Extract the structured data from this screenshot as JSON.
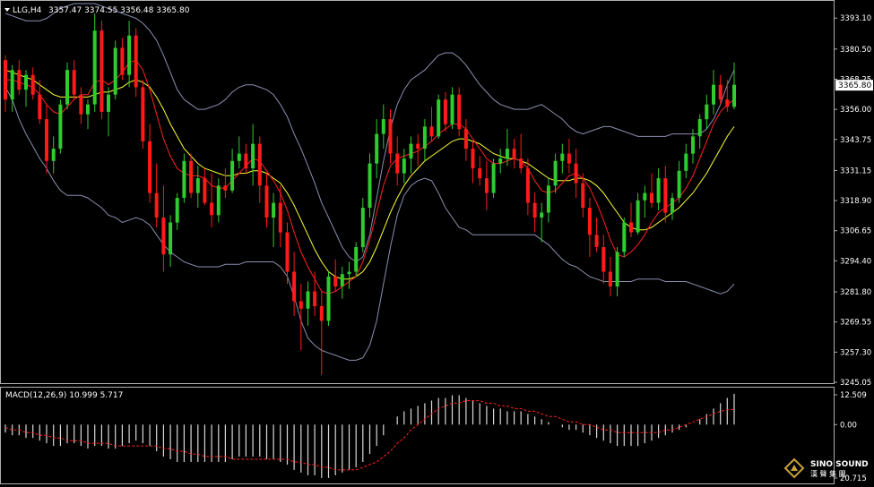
{
  "chart_header": {
    "symbol": "LLG,H4",
    "ohlc": "3357.47 3374.55 3356.48 3365.80"
  },
  "price_axis": {
    "ticks": [
      3393.1,
      3380.5,
      3368.25,
      3356.0,
      3343.75,
      3331.15,
      3318.9,
      3306.65,
      3294.4,
      3281.8,
      3269.55,
      3257.3,
      3245.05
    ],
    "ylim": [
      3245.05,
      3399.0
    ],
    "current_price": "3365.80"
  },
  "macd_panel": {
    "label": "MACD(12,26,9) 10.999 5.717",
    "ticks": [
      "12.509",
      "0.00",
      "20.715"
    ],
    "ylim": [
      -20.715,
      12.509
    ]
  },
  "watermark": {
    "brand": "SINO SOUND",
    "sub": "漢 聲 集 團"
  },
  "colors": {
    "up": "#2ecc2e",
    "down": "#ff1a1a",
    "ma_fast": "#ff2020",
    "ma_slow": "#ffff33",
    "bands": "#8a8fb0",
    "histogram": "#d8d8d8",
    "signal": "#ff2020"
  },
  "chart_data": {
    "type": "candlestick",
    "title": "LLG,H4",
    "candles": [
      [
        3376,
        3378,
        3355,
        3360
      ],
      [
        3360,
        3374,
        3355,
        3372
      ],
      [
        3372,
        3376,
        3362,
        3364
      ],
      [
        3364,
        3372,
        3357,
        3370
      ],
      [
        3370,
        3373,
        3360,
        3362
      ],
      [
        3362,
        3368,
        3350,
        3352
      ],
      [
        3352,
        3358,
        3330,
        3335
      ],
      [
        3335,
        3345,
        3330,
        3340
      ],
      [
        3340,
        3360,
        3338,
        3358
      ],
      [
        3358,
        3375,
        3356,
        3372
      ],
      [
        3372,
        3376,
        3360,
        3362
      ],
      [
        3362,
        3365,
        3350,
        3354
      ],
      [
        3354,
        3360,
        3348,
        3358
      ],
      [
        3358,
        3395,
        3355,
        3388
      ],
      [
        3388,
        3392,
        3352,
        3355
      ],
      [
        3355,
        3365,
        3345,
        3362
      ],
      [
        3362,
        3384,
        3360,
        3381
      ],
      [
        3381,
        3385,
        3368,
        3370
      ],
      [
        3370,
        3392,
        3365,
        3386
      ],
      [
        3386,
        3389,
        3361,
        3365
      ],
      [
        3365,
        3368,
        3340,
        3343
      ],
      [
        3343,
        3350,
        3318,
        3322
      ],
      [
        3322,
        3334,
        3308,
        3312
      ],
      [
        3312,
        3325,
        3290,
        3297
      ],
      [
        3297,
        3313,
        3292,
        3310
      ],
      [
        3310,
        3322,
        3307,
        3320
      ],
      [
        3320,
        3338,
        3318,
        3335
      ],
      [
        3335,
        3338,
        3320,
        3322
      ],
      [
        3322,
        3333,
        3316,
        3328
      ],
      [
        3328,
        3332,
        3317,
        3318
      ],
      [
        3318,
        3330,
        3308,
        3313
      ],
      [
        3313,
        3328,
        3310,
        3325
      ],
      [
        3325,
        3332,
        3320,
        3323
      ],
      [
        3323,
        3340,
        3322,
        3335
      ],
      [
        3335,
        3345,
        3332,
        3338
      ],
      [
        3338,
        3342,
        3330,
        3332
      ],
      [
        3332,
        3350,
        3325,
        3342
      ],
      [
        3342,
        3345,
        3318,
        3325
      ],
      [
        3325,
        3330,
        3308,
        3312
      ],
      [
        3312,
        3322,
        3300,
        3318
      ],
      [
        3318,
        3325,
        3300,
        3306
      ],
      [
        3306,
        3310,
        3285,
        3290
      ],
      [
        3290,
        3298,
        3272,
        3278
      ],
      [
        3278,
        3285,
        3258,
        3275
      ],
      [
        3275,
        3286,
        3268,
        3282
      ],
      [
        3282,
        3290,
        3272,
        3276
      ],
      [
        3276,
        3282,
        3248,
        3270
      ],
      [
        3270,
        3290,
        3268,
        3288
      ],
      [
        3288,
        3295,
        3282,
        3284
      ],
      [
        3284,
        3292,
        3279,
        3289
      ],
      [
        3289,
        3294,
        3283,
        3290
      ],
      [
        3290,
        3302,
        3288,
        3300
      ],
      [
        3300,
        3320,
        3298,
        3316
      ],
      [
        3316,
        3338,
        3312,
        3334
      ],
      [
        3334,
        3352,
        3328,
        3346
      ],
      [
        3346,
        3358,
        3340,
        3352
      ],
      [
        3352,
        3356,
        3334,
        3338
      ],
      [
        3338,
        3345,
        3325,
        3330
      ],
      [
        3330,
        3340,
        3326,
        3336
      ],
      [
        3336,
        3345,
        3330,
        3342
      ],
      [
        3342,
        3346,
        3333,
        3340
      ],
      [
        3340,
        3352,
        3335,
        3349
      ],
      [
        3349,
        3357,
        3343,
        3345
      ],
      [
        3345,
        3362,
        3344,
        3360
      ],
      [
        3360,
        3363,
        3347,
        3350
      ],
      [
        3350,
        3365,
        3348,
        3362
      ],
      [
        3362,
        3365,
        3345,
        3348
      ],
      [
        3348,
        3352,
        3335,
        3340
      ],
      [
        3340,
        3343,
        3326,
        3332
      ],
      [
        3332,
        3337,
        3325,
        3328
      ],
      [
        3328,
        3335,
        3315,
        3322
      ],
      [
        3322,
        3336,
        3320,
        3334
      ],
      [
        3334,
        3340,
        3330,
        3336
      ],
      [
        3336,
        3348,
        3333,
        3340
      ],
      [
        3340,
        3344,
        3332,
        3336
      ],
      [
        3336,
        3346,
        3330,
        3332
      ],
      [
        3332,
        3336,
        3313,
        3318
      ],
      [
        3318,
        3322,
        3306,
        3312
      ],
      [
        3312,
        3318,
        3302,
        3314
      ],
      [
        3314,
        3328,
        3310,
        3325
      ],
      [
        3325,
        3338,
        3322,
        3335
      ],
      [
        3335,
        3342,
        3330,
        3338
      ],
      [
        3338,
        3344,
        3330,
        3334
      ],
      [
        3334,
        3340,
        3320,
        3326
      ],
      [
        3326,
        3330,
        3312,
        3316
      ],
      [
        3316,
        3320,
        3296,
        3305
      ],
      [
        3305,
        3312,
        3298,
        3300
      ],
      [
        3300,
        3305,
        3285,
        3290
      ],
      [
        3290,
        3296,
        3280,
        3284
      ],
      [
        3284,
        3300,
        3280,
        3298
      ],
      [
        3298,
        3312,
        3296,
        3310
      ],
      [
        3310,
        3318,
        3304,
        3306
      ],
      [
        3306,
        3322,
        3305,
        3319
      ],
      [
        3319,
        3325,
        3312,
        3322
      ],
      [
        3322,
        3330,
        3316,
        3318
      ],
      [
        3318,
        3332,
        3315,
        3328
      ],
      [
        3328,
        3333,
        3310,
        3314
      ],
      [
        3314,
        3322,
        3311,
        3320
      ],
      [
        3320,
        3335,
        3318,
        3331
      ],
      [
        3331,
        3342,
        3328,
        3338
      ],
      [
        3338,
        3348,
        3334,
        3345
      ],
      [
        3345,
        3354,
        3340,
        3352
      ],
      [
        3352,
        3362,
        3348,
        3358
      ],
      [
        3358,
        3372,
        3354,
        3366
      ],
      [
        3366,
        3370,
        3358,
        3360
      ],
      [
        3360,
        3368,
        3355,
        3357
      ],
      [
        3357,
        3375,
        3356,
        3366
      ]
    ],
    "ma_fast": [
      3368,
      3368,
      3367,
      3366,
      3365,
      3362,
      3358,
      3355,
      3354,
      3357,
      3360,
      3362,
      3362,
      3367,
      3368,
      3366,
      3368,
      3371,
      3375,
      3376,
      3372,
      3364,
      3354,
      3344,
      3337,
      3332,
      3330,
      3329,
      3329,
      3328,
      3325,
      3324,
      3324,
      3327,
      3330,
      3333,
      3336,
      3335,
      3331,
      3327,
      3322,
      3315,
      3306,
      3298,
      3292,
      3287,
      3282,
      3281,
      3282,
      3284,
      3286,
      3288,
      3294,
      3303,
      3314,
      3325,
      3333,
      3336,
      3337,
      3338,
      3339,
      3341,
      3343,
      3346,
      3348,
      3350,
      3350,
      3348,
      3344,
      3340,
      3336,
      3334,
      3334,
      3335,
      3336,
      3335,
      3332,
      3327,
      3323,
      3322,
      3323,
      3326,
      3329,
      3330,
      3328,
      3324,
      3318,
      3311,
      3303,
      3297,
      3296,
      3298,
      3301,
      3305,
      3310,
      3314,
      3316,
      3318,
      3320,
      3324,
      3329,
      3336,
      3343,
      3350,
      3355,
      3358,
      3360
    ],
    "ma_slow": [
      3372,
      3371,
      3370,
      3369,
      3368,
      3366,
      3364,
      3362,
      3361,
      3361,
      3361,
      3361,
      3361,
      3362,
      3363,
      3363,
      3364,
      3365,
      3367,
      3368,
      3367,
      3365,
      3361,
      3356,
      3350,
      3345,
      3340,
      3337,
      3334,
      3332,
      3331,
      3330,
      3329,
      3329,
      3330,
      3330,
      3331,
      3331,
      3330,
      3328,
      3326,
      3322,
      3317,
      3311,
      3305,
      3299,
      3294,
      3290,
      3288,
      3287,
      3287,
      3288,
      3290,
      3294,
      3300,
      3307,
      3314,
      3320,
      3325,
      3329,
      3332,
      3335,
      3337,
      3339,
      3341,
      3343,
      3344,
      3344,
      3343,
      3342,
      3340,
      3338,
      3337,
      3336,
      3336,
      3335,
      3334,
      3332,
      3330,
      3328,
      3327,
      3327,
      3327,
      3328,
      3328,
      3327,
      3325,
      3322,
      3318,
      3314,
      3310,
      3308,
      3307,
      3307,
      3308,
      3310,
      3312,
      3314,
      3316,
      3319,
      3322,
      3326,
      3330,
      3335,
      3340,
      3345,
      3349
    ],
    "bb_upper": [
      3395,
      3394,
      3393,
      3392,
      3392,
      3392,
      3393,
      3395,
      3397,
      3398,
      3399,
      3399,
      3399,
      3399,
      3398,
      3397,
      3396,
      3395,
      3394,
      3393,
      3391,
      3388,
      3384,
      3378,
      3371,
      3364,
      3360,
      3358,
      3356,
      3356,
      3357,
      3358,
      3360,
      3363,
      3365,
      3366,
      3366,
      3365,
      3364,
      3362,
      3358,
      3353,
      3346,
      3340,
      3333,
      3326,
      3318,
      3312,
      3306,
      3300,
      3296,
      3294,
      3296,
      3305,
      3320,
      3335,
      3348,
      3358,
      3364,
      3368,
      3370,
      3372,
      3375,
      3378,
      3379,
      3379,
      3377,
      3374,
      3370,
      3366,
      3363,
      3360,
      3358,
      3357,
      3356,
      3356,
      3356,
      3357,
      3358,
      3356,
      3354,
      3352,
      3349,
      3347,
      3346,
      3347,
      3348,
      3349,
      3349,
      3348,
      3347,
      3346,
      3345,
      3345,
      3345,
      3345,
      3345,
      3346,
      3346,
      3346,
      3346,
      3346,
      3348,
      3352,
      3358,
      3366,
      3372
    ],
    "bb_lower": [
      3365,
      3360,
      3352,
      3346,
      3341,
      3336,
      3332,
      3327,
      3323,
      3321,
      3321,
      3321,
      3320,
      3318,
      3316,
      3313,
      3312,
      3310,
      3311,
      3312,
      3311,
      3309,
      3305,
      3301,
      3298,
      3296,
      3294,
      3293,
      3292,
      3292,
      3292,
      3292,
      3293,
      3293,
      3293,
      3294,
      3294,
      3294,
      3294,
      3294,
      3292,
      3288,
      3280,
      3270,
      3263,
      3260,
      3258,
      3257,
      3256,
      3255,
      3254,
      3254,
      3255,
      3260,
      3270,
      3285,
      3300,
      3313,
      3321,
      3325,
      3327,
      3328,
      3327,
      3322,
      3316,
      3312,
      3308,
      3307,
      3305,
      3305,
      3305,
      3305,
      3305,
      3305,
      3305,
      3305,
      3305,
      3305,
      3303,
      3301,
      3298,
      3295,
      3293,
      3292,
      3290,
      3288,
      3287,
      3286,
      3286,
      3286,
      3286,
      3286,
      3287,
      3287,
      3287,
      3287,
      3286,
      3286,
      3286,
      3286,
      3285,
      3284,
      3283,
      3282,
      3281,
      3282,
      3285
    ],
    "macd_hist": [
      -3,
      -4,
      -4,
      -5,
      -5,
      -6,
      -7,
      -8,
      -8,
      -7,
      -7,
      -8,
      -9,
      -8,
      -8,
      -9,
      -9,
      -8,
      -7,
      -6,
      -7,
      -8,
      -10,
      -12,
      -13,
      -14,
      -14,
      -14,
      -14,
      -14,
      -14,
      -14,
      -14,
      -13,
      -12,
      -12,
      -12,
      -12,
      -13,
      -13,
      -14,
      -15,
      -17,
      -18,
      -19,
      -19,
      -20,
      -20,
      -19,
      -18,
      -17,
      -16,
      -14,
      -11,
      -8,
      -4,
      0,
      3,
      5,
      6,
      7,
      8,
      9,
      10,
      10,
      11,
      11,
      10,
      9,
      8,
      7,
      6,
      6,
      5,
      5,
      5,
      4,
      3,
      2,
      1,
      0,
      -1,
      -2,
      -2,
      -3,
      -4,
      -5,
      -6,
      -7,
      -8,
      -8,
      -8,
      -8,
      -7,
      -6,
      -5,
      -4,
      -3,
      -2,
      -1,
      0,
      2,
      4,
      6,
      8,
      10,
      11.5
    ],
    "macd_signal": [
      -1,
      -2,
      -2,
      -3,
      -3,
      -4,
      -4,
      -5,
      -5,
      -6,
      -6,
      -6,
      -7,
      -7,
      -7,
      -7,
      -8,
      -8,
      -8,
      -8,
      -8,
      -8,
      -8,
      -9,
      -9,
      -10,
      -10,
      -11,
      -11,
      -12,
      -12,
      -12,
      -12,
      -13,
      -13,
      -13,
      -13,
      -13,
      -13,
      -13,
      -13,
      -13,
      -14,
      -14,
      -15,
      -15,
      -16,
      -16,
      -17,
      -17,
      -17,
      -17,
      -16,
      -15,
      -14,
      -12,
      -10,
      -7,
      -5,
      -2,
      0,
      2,
      4,
      6,
      7,
      8,
      8,
      9,
      9,
      9,
      8,
      8,
      7,
      7,
      6,
      6,
      5,
      5,
      4,
      3,
      3,
      2,
      1,
      1,
      0,
      0,
      -1,
      -2,
      -2,
      -3,
      -3,
      -3,
      -3,
      -3,
      -3,
      -3,
      -2,
      -2,
      -1,
      0,
      1,
      2,
      3,
      4,
      5,
      5.5,
      5.7
    ]
  }
}
